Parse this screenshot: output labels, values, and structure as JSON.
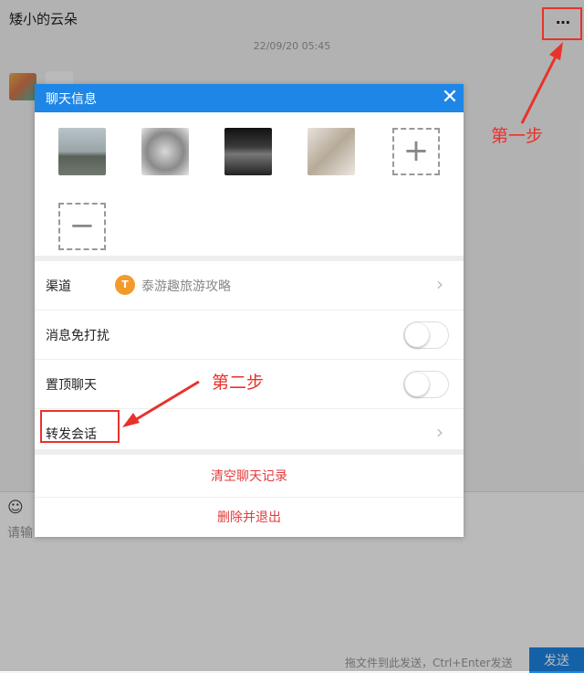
{
  "chat": {
    "title": "矮小的云朵",
    "more_label": "…",
    "timestamp": "22/09/20 05:45",
    "input_placeholder": "请输",
    "send_hint": "拖文件到此发送，Ctrl+Enter发送",
    "send_label": "发送"
  },
  "dialog": {
    "title": "聊天信息",
    "close_label": "✕",
    "members": [
      "member-1",
      "member-2",
      "member-3",
      "member-4"
    ],
    "add_label": "+",
    "remove_label": "−",
    "channel": {
      "label": "渠道",
      "logo_text": "T",
      "name": "泰游趣旅游攻略"
    },
    "mute": {
      "label": "消息免打扰",
      "on": false
    },
    "pin": {
      "label": "置顶聊天",
      "on": false
    },
    "forward": {
      "label": "转发会话"
    },
    "clear_label": "清空聊天记录",
    "delete_label": "删除并退出"
  },
  "annotations": {
    "step1": "第一步",
    "step2": "第二步",
    "color": "#e8322c"
  },
  "colors": {
    "accent": "#1e86e6",
    "danger": "#e23c3c",
    "channel_logo": "#f39b2a"
  }
}
